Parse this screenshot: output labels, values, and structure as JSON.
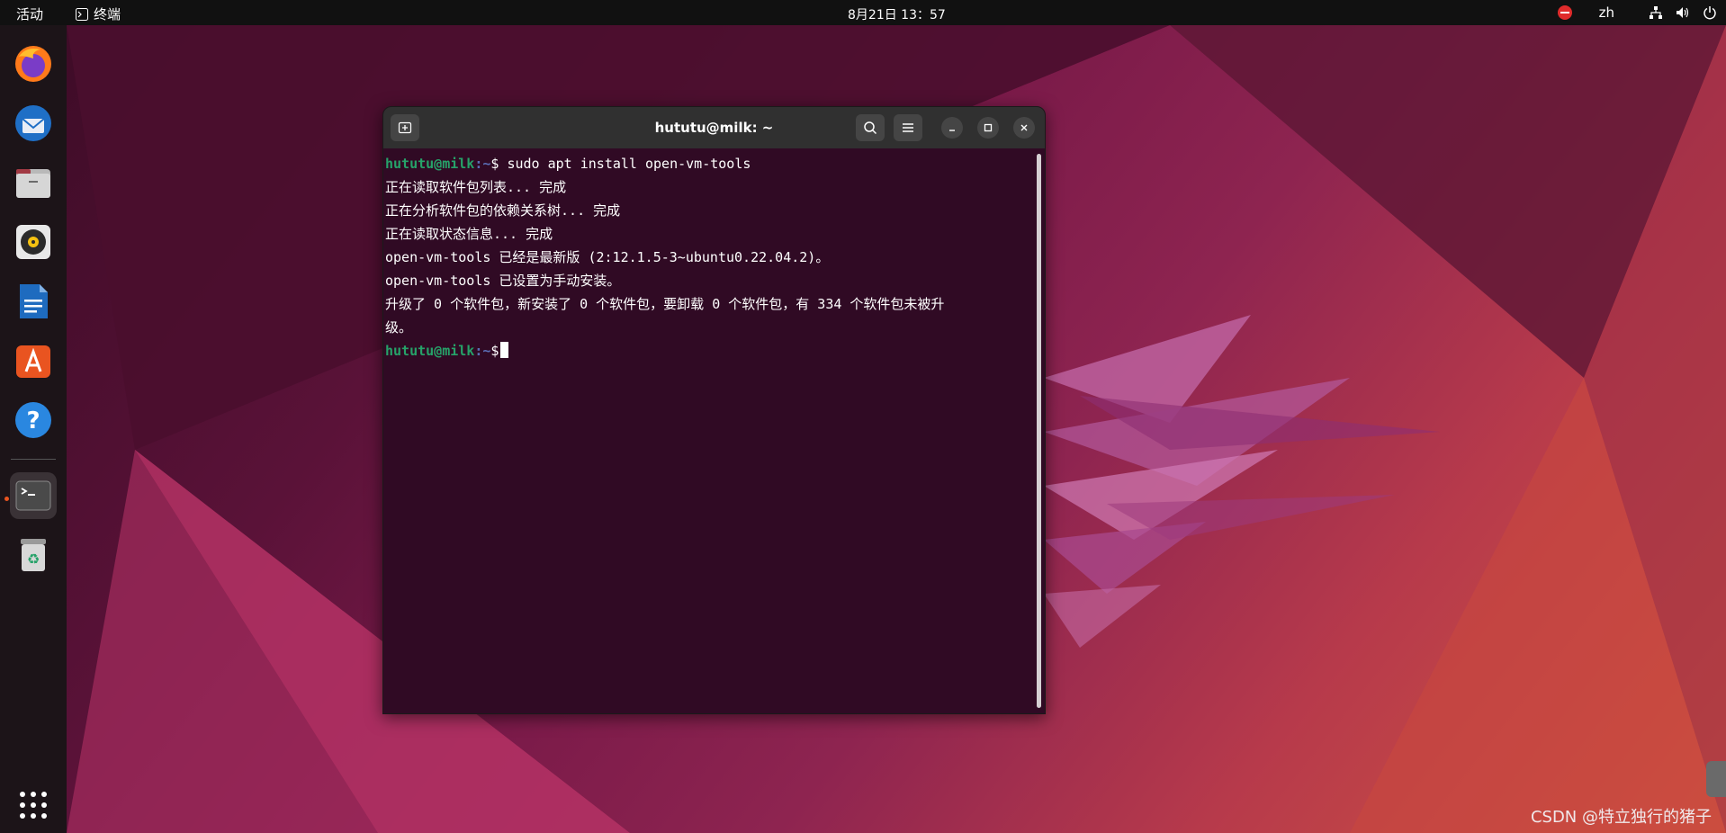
{
  "topbar": {
    "activities": "活动",
    "app_name": "终端",
    "clock": "8月21日  13：57",
    "input_method": "zh"
  },
  "dock": {
    "items": [
      {
        "name": "firefox-icon"
      },
      {
        "name": "thunderbird-icon"
      },
      {
        "name": "files-icon"
      },
      {
        "name": "rhythmbox-icon"
      },
      {
        "name": "libreoffice-writer-icon"
      },
      {
        "name": "app-center-icon"
      },
      {
        "name": "help-icon"
      },
      {
        "name": "terminal-icon"
      },
      {
        "name": "trash-icon"
      }
    ]
  },
  "terminal": {
    "title": "hututu@milk: ~",
    "prompt_user": "hututu@milk",
    "prompt_path": ":~",
    "prompt_symbol": "$",
    "command": " sudo apt install open-vm-tools",
    "output": [
      "正在读取软件包列表... 完成",
      "正在分析软件包的依赖关系树... 完成",
      "正在读取状态信息... 完成",
      "open-vm-tools 已经是最新版 (2:12.1.5-3~ubuntu0.22.04.2)。",
      "open-vm-tools 已设置为手动安装。",
      "升级了 0 个软件包，新安装了 0 个软件包，要卸载 0 个软件包，有 334 个软件包未被升",
      "级。"
    ]
  },
  "watermark": "CSDN @特立独行的猪子",
  "colors": {
    "terminal_bg": "#300a24",
    "prompt_user": "#26a269",
    "prompt_path": "#5a6eb5",
    "accent": "#e95420"
  }
}
